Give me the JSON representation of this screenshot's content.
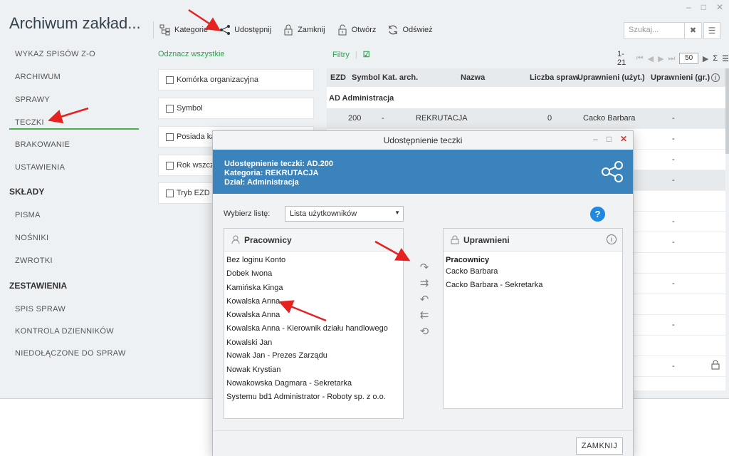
{
  "app": {
    "title": "Archiwum zakład..."
  },
  "window_controls": {
    "minimize": "–",
    "maximize": "□",
    "close": "✕"
  },
  "toolbar": {
    "items": [
      {
        "label": "Kategorie",
        "icon": "hierarchy-icon"
      },
      {
        "label": "Udostępnij",
        "icon": "share-icon"
      },
      {
        "label": "Zamknij",
        "icon": "lock-icon"
      },
      {
        "label": "Otwórz",
        "icon": "unlock-icon"
      },
      {
        "label": "Odśwież",
        "icon": "refresh-icon"
      }
    ]
  },
  "search": {
    "placeholder": "Szukaj..."
  },
  "sidebar": {
    "items": [
      {
        "label": "WYKAZ SPISÓW Z-O",
        "type": "item"
      },
      {
        "label": "ARCHIWUM",
        "type": "item"
      },
      {
        "label": "SPRAWY",
        "type": "item"
      },
      {
        "label": "TECZKI",
        "type": "item",
        "active": true
      },
      {
        "label": "BRAKOWANIE",
        "type": "item"
      },
      {
        "label": "USTAWIENIA",
        "type": "item"
      },
      {
        "label": "SKŁADY",
        "type": "section"
      },
      {
        "label": "PISMA",
        "type": "item"
      },
      {
        "label": "NOŚNIKI",
        "type": "item"
      },
      {
        "label": "ZWROTKI",
        "type": "item"
      },
      {
        "label": "ZESTAWIENIA",
        "type": "section"
      },
      {
        "label": "SPIS SPRAW",
        "type": "item"
      },
      {
        "label": "KONTROLA DZIENNIKÓW",
        "type": "item"
      },
      {
        "label": "NIEDOŁĄCZONE DO SPRAW",
        "type": "item"
      }
    ]
  },
  "filters": {
    "mark_all": "Odznacz wszystkie",
    "items": [
      "Komórka organizacyjna",
      "Symbol",
      "Posiada ka",
      "Rok wszcze",
      "Tryb EZD"
    ]
  },
  "grid": {
    "filters_label": "Filtry",
    "pager": {
      "range": "1-21",
      "page_size": "50"
    },
    "columns": [
      "EZD",
      "Symbol",
      "Kat. arch.",
      "Nazwa",
      "Liczba spraw",
      "Uprawnieni (użyt.)",
      "Uprawnieni (gr.)"
    ],
    "group_label": "AD Administracja",
    "first_row": {
      "symbol": "200",
      "kat": "-",
      "nazwa": "REKRUTACJA",
      "liczba": "0",
      "uzyt": "Cacko Barbara",
      "gr": "-"
    },
    "dash": "-"
  },
  "modal": {
    "title": "Udostępnienie teczki",
    "header": {
      "line1": "Udostępnienie teczki: AD.200",
      "line2": "Kategoria: REKRUTACJA",
      "line3": "Dział: Administracja"
    },
    "list_label": "Wybierz listę:",
    "list_value": "Lista użytkowników",
    "left_panel": {
      "title": "Pracownicy",
      "items": [
        "Bez loginu Konto",
        "Dobek Iwona",
        "Kamińska Kinga",
        "Kowalska Anna",
        "Kowalska Anna",
        "Kowalska Anna - Kierownik działu handlowego",
        "Kowalski Jan",
        "Nowak Jan - Prezes Zarządu",
        "Nowak Krystian",
        "Nowakowska Dagmara - Sekretarka",
        "Systemu bd1 Administrator - Roboty sp. z o.o."
      ]
    },
    "right_panel": {
      "title": "Uprawnieni",
      "group": "Pracownicy",
      "items": [
        "Cacko Barbara",
        "Cacko Barbara - Sekretarka"
      ]
    },
    "close_label": "ZAMKNIJ"
  }
}
